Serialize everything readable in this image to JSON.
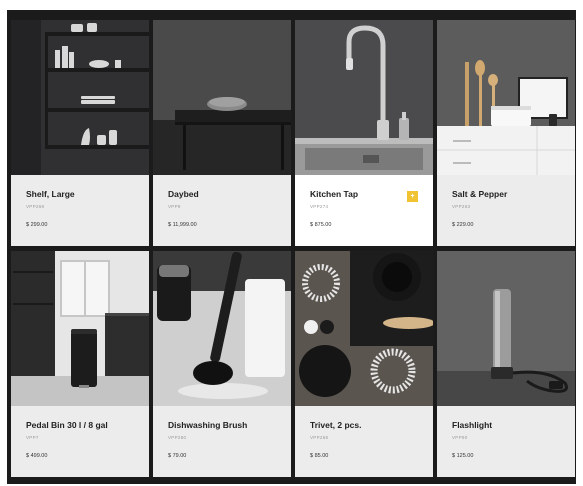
{
  "products": [
    {
      "name": "Shelf, Large",
      "sku": "VPP269",
      "price": "$ 299.00"
    },
    {
      "name": "Daybed",
      "sku": "VPP9",
      "price": "$ 11,999.00"
    },
    {
      "name": "Kitchen Tap",
      "sku": "VPP274",
      "price": "$ 875.00"
    },
    {
      "name": "Salt & Pepper",
      "sku": "VPP263",
      "price": "$ 229.00"
    },
    {
      "name": "Pedal Bin 30 l / 8 gal",
      "sku": "VPP7",
      "price": "$ 499.00"
    },
    {
      "name": "Dishwashing Brush",
      "sku": "VPP280",
      "price": "$ 79.00"
    },
    {
      "name": "Trivet, 2 pcs.",
      "sku": "VPP268",
      "price": "$ 85.00"
    },
    {
      "name": "Flashlight",
      "sku": "VPP90",
      "price": "$ 125.00"
    }
  ],
  "active_card": {
    "add_icon": "+",
    "accent_color": "#f1c232"
  }
}
